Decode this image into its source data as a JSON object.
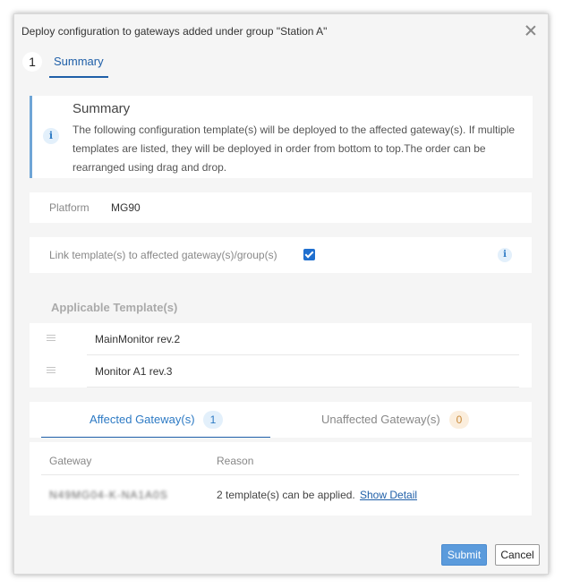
{
  "dialog": {
    "title": "Deploy configuration to gateways added under group \"Station A\""
  },
  "steps": [
    {
      "number": "1",
      "label": "Summary"
    }
  ],
  "summary": {
    "title": "Summary",
    "text": "The following configuration template(s) will be deployed to the affected gateway(s). If multiple templates are listed, they will be deployed in order from bottom to top.The order can be rearranged using drag and drop.",
    "icon": "info-icon"
  },
  "platform": {
    "label": "Platform",
    "value": "MG90"
  },
  "link_templates": {
    "label": "Link template(s) to affected gateway(s)/group(s)",
    "checked": true
  },
  "applicable_templates": {
    "title": "Applicable Template(s)",
    "items": [
      {
        "name": "MainMonitor rev.2"
      },
      {
        "name": "Monitor A1 rev.3"
      }
    ]
  },
  "tabs": [
    {
      "label": "Affected Gateway(s)",
      "count": "1",
      "active": true
    },
    {
      "label": "Unaffected Gateway(s)",
      "count": "0",
      "active": false
    }
  ],
  "gateway_table": {
    "columns": [
      "Gateway",
      "Reason"
    ],
    "rows": [
      {
        "gateway": "N49MG04-K-NA1A0S",
        "reason": "2 template(s) can be applied.",
        "action": "Show Detail"
      }
    ]
  },
  "footer": {
    "submit_label": "Submit",
    "cancel_label": "Cancel"
  },
  "colors": {
    "accent": "#1f5fa8",
    "submit_bg": "#5b9bdc",
    "badge_unaffected_bg": "#fbeedd"
  }
}
